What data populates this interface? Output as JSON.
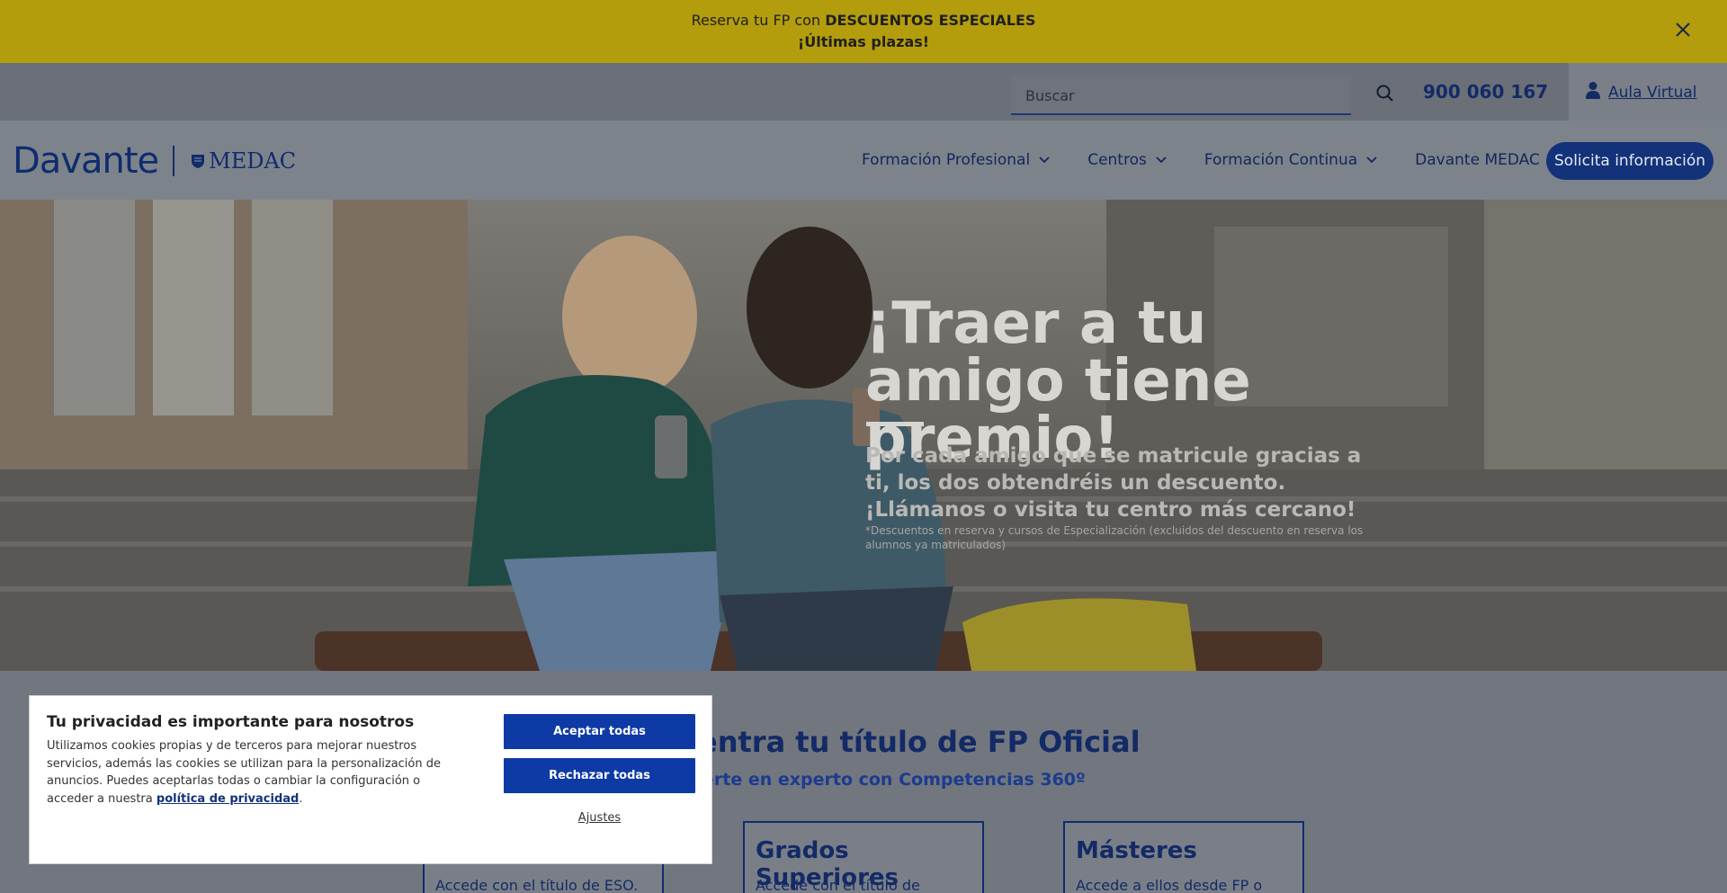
{
  "promo": {
    "line1_prefix": "Reserva tu FP con ",
    "line1_bold": "DESCUENTOS ESPECIALES",
    "line2": "¡Últimas plazas!",
    "close_icon": "close-icon"
  },
  "utility": {
    "search_placeholder": "Buscar",
    "search_icon": "search-icon",
    "phone": "900 060 167",
    "aula_label": "Aula Virtual",
    "aula_icon": "user-icon"
  },
  "nav": {
    "logo_text": "Davante",
    "logo_partner": "MEDAC",
    "items": [
      {
        "label": "Formación Profesional"
      },
      {
        "label": "Centros"
      },
      {
        "label": "Formación Continua"
      },
      {
        "label": "Davante MEDAC"
      }
    ],
    "cta": "Solicita información"
  },
  "hero": {
    "title": "¡Traer a tu amigo tiene premio!",
    "text": "Por cada amigo que se matricule gracias a ti, los dos obtendréis un descuento. ¡Llámanos o visita tu centro más cercano!",
    "note": "*Descuentos en reserva y cursos de Especialización (excluidos del descuento en reserva los alumnos ya matriculados)"
  },
  "section": {
    "title": "entra tu título de FP Oficial",
    "subtitle": "érte en experto con Competencias 360º",
    "cards": [
      {
        "title": "",
        "desc": "Accede con el título de ESO."
      },
      {
        "title": "Grados Superiores",
        "desc": "Accede con el título de"
      },
      {
        "title": "Másteres",
        "desc": "Accede a ellos desde FP o"
      }
    ]
  },
  "cookie": {
    "title": "Tu privacidad es importante para nosotros",
    "text": "Utilizamos cookies propias y de terceros para mejorar nuestros servicios, además las cookies se utilizan para la personalización de anuncios. Puedes aceptarlas todas o cambiar la configuración o acceder a nuestra",
    "link": "política de privacidad",
    "link_suffix": ".",
    "accept": "Aceptar todas",
    "reject": "Rechazar todas",
    "settings": "Ajustes"
  }
}
